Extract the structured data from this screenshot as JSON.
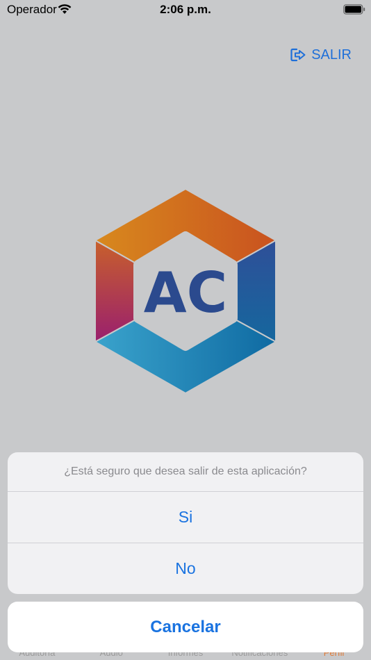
{
  "status_bar": {
    "carrier": "Operador",
    "time": "2:06 p.m."
  },
  "header": {
    "logout_label": "SALIR"
  },
  "logo": {
    "text": "AC"
  },
  "tab_bar": {
    "tabs": [
      {
        "label": "Auditoría"
      },
      {
        "label": "Audio"
      },
      {
        "label": "Informes"
      },
      {
        "label": "Notificaciones"
      },
      {
        "label": "Perfil"
      }
    ],
    "active_index": 4
  },
  "action_sheet": {
    "title": "¿Está seguro que desea salir de esta aplicación?",
    "options": [
      {
        "label": "Si"
      },
      {
        "label": "No"
      }
    ],
    "cancel_label": "Cancelar"
  },
  "colors": {
    "accent": "#1a73e0",
    "active_tab": "#e07a36",
    "logo_text": "#2b4a8e"
  }
}
